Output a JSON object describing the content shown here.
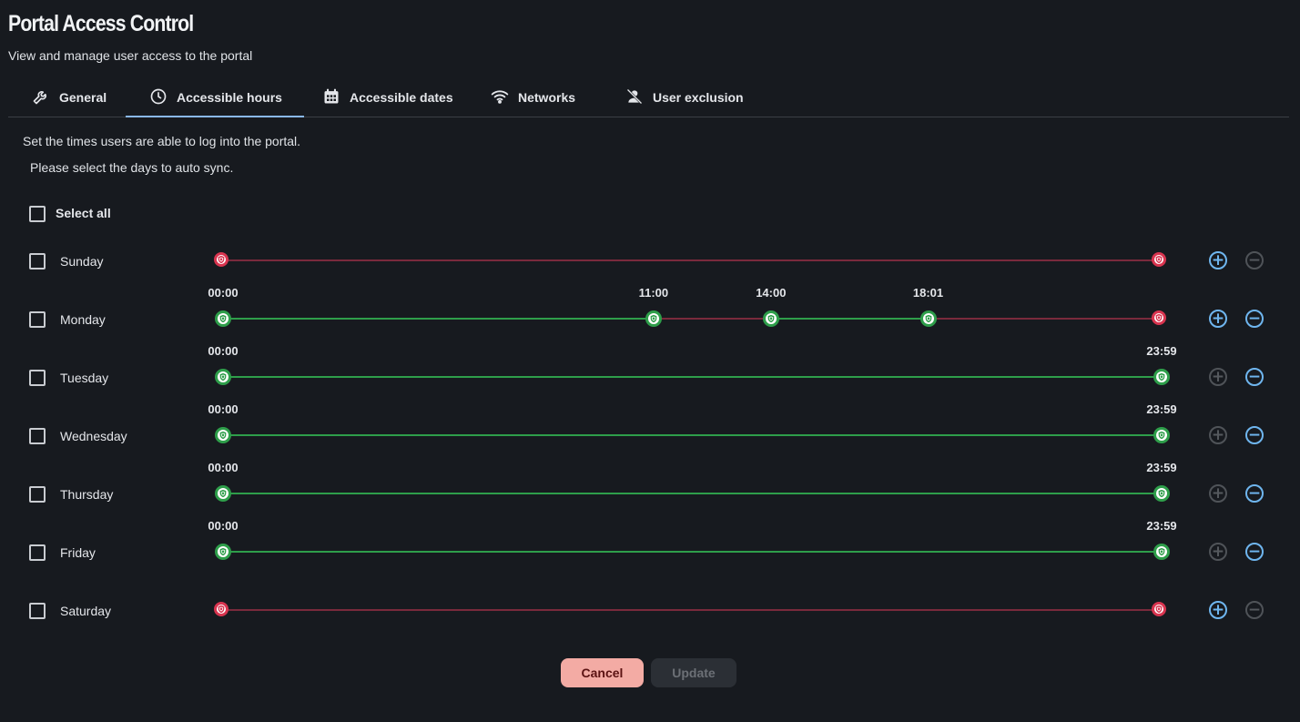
{
  "header": {
    "title": "Portal Access Control",
    "subtitle": "View and manage user access to the portal"
  },
  "tabs": [
    {
      "label": "General",
      "icon": "wrench-icon",
      "active": false
    },
    {
      "label": "Accessible hours",
      "icon": "clock-icon",
      "active": true
    },
    {
      "label": "Accessible dates",
      "icon": "calendar-icon",
      "active": false
    },
    {
      "label": "Networks",
      "icon": "wifi-icon",
      "active": false
    },
    {
      "label": "User exclusion",
      "icon": "user-exclusion-icon",
      "active": false
    }
  ],
  "content": {
    "description": "Set the times users are able to log into the portal.",
    "sync_prompt": "Please select the days to auto sync.",
    "select_all_label": "Select all"
  },
  "days": [
    {
      "name": "Sunday",
      "checked": false,
      "enabled": false,
      "times": [],
      "add_enabled": true,
      "remove_enabled": false
    },
    {
      "name": "Monday",
      "checked": false,
      "enabled": true,
      "times": [
        "00:00",
        "11:00",
        "14:00",
        "18:01"
      ],
      "add_enabled": true,
      "remove_enabled": true
    },
    {
      "name": "Tuesday",
      "checked": false,
      "enabled": true,
      "times": [
        "00:00",
        "23:59"
      ],
      "add_enabled": false,
      "remove_enabled": true
    },
    {
      "name": "Wednesday",
      "checked": false,
      "enabled": true,
      "times": [
        "00:00",
        "23:59"
      ],
      "add_enabled": false,
      "remove_enabled": true
    },
    {
      "name": "Thursday",
      "checked": false,
      "enabled": true,
      "times": [
        "00:00",
        "23:59"
      ],
      "add_enabled": false,
      "remove_enabled": true
    },
    {
      "name": "Friday",
      "checked": false,
      "enabled": true,
      "times": [
        "00:00",
        "23:59"
      ],
      "add_enabled": false,
      "remove_enabled": true
    },
    {
      "name": "Saturday",
      "checked": false,
      "enabled": false,
      "times": [],
      "add_enabled": true,
      "remove_enabled": false
    }
  ],
  "actions": {
    "cancel_label": "Cancel",
    "update_label": "Update"
  },
  "colors": {
    "accent": "#8ab8f0",
    "allowed": "#2e9e4a",
    "denied": "#d8344f",
    "denied_track": "#7a2a3c",
    "cancel_bg": "#f3aba4"
  }
}
